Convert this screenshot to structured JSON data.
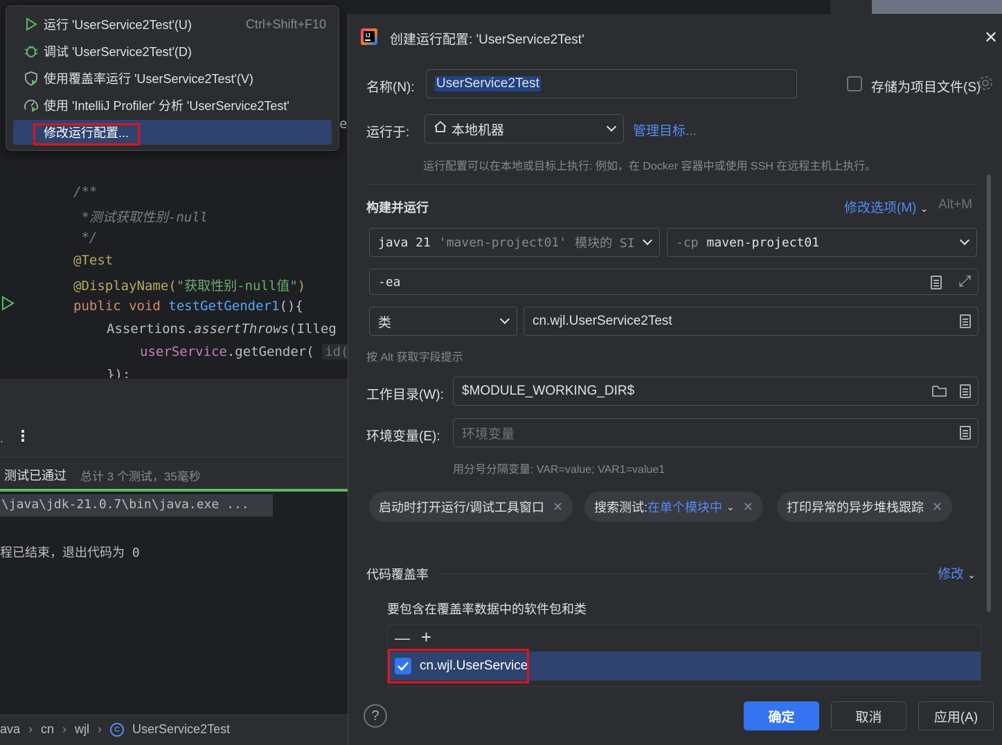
{
  "menu": {
    "items": [
      {
        "label": "运行 'UserService2Test'(U)",
        "shortcut": "Ctrl+Shift+F10",
        "icon": "run-icon"
      },
      {
        "label": "调试 'UserService2Test'(D)",
        "shortcut": "",
        "icon": "debug-icon"
      },
      {
        "label": "使用覆盖率运行 'UserService2Test'(V)",
        "shortcut": "",
        "icon": "coverage-icon"
      },
      {
        "label": "使用 'IntelliJ Profiler' 分析  'UserService2Test'",
        "shortcut": "",
        "icon": "profiler-icon"
      },
      {
        "label": "修改运行配置...",
        "shortcut": "",
        "icon": ""
      }
    ]
  },
  "editor": {
    "lines": {
      "l1": "/**",
      "l2": " *测试获取性别-null",
      "l3": " */",
      "l4": "@Test",
      "l5a": "@DisplayName(",
      "l5b": "\"获取性别-null值\"",
      "l5c": ")",
      "l6a": "public void ",
      "l6b": "testGetGender1",
      "l6c": "(){",
      "l7a": "Assertions.",
      "l7b": "assertThrows",
      "l7c": "(Illeg",
      "l8a": "userService",
      "l8b": ".getGender( ",
      "l8c": "id(",
      "l9": "});"
    },
    "stray_e": "e"
  },
  "run_panel": {
    "status": "测试已通过",
    "summary": "总计 3 个测试，35毫秒",
    "console_line1": "\\java\\jdk-21.0.7\\bin\\java.exe ...",
    "console_line2": "程已结束，退出代码为 0"
  },
  "breadcrumb": {
    "items": [
      "ava",
      "cn",
      "wjl",
      "UserService2Test"
    ]
  },
  "dialog": {
    "title": "创建运行配置: 'UserService2Test'",
    "name_label": "名称(N):",
    "name_value": "UserService2Test",
    "store_label": "存储为项目文件(S)",
    "run_on_label": "运行于:",
    "run_on_value": "本地机器",
    "manage_targets": "管理目标...",
    "run_on_hint": "运行配置可以在本地或目标上执行: 例如，在 Docker 容器中或使用 SSH 在远程主机上执行。",
    "build_run_title": "构建并运行",
    "modify_options": "修改选项(M)",
    "modify_shortcut": "Alt+M",
    "jdk_prefix": "java 21",
    "jdk_module": "'maven-project01'",
    "jdk_suffix": "模块的 SI",
    "cp_prefix": "-cp",
    "cp_value": "maven-project01",
    "vm_options": "-ea",
    "kind_value": "类",
    "class_value": "cn.wjl.UserService2Test",
    "alt_hint": "按 Alt 获取字段提示",
    "workdir_label": "工作目录(W):",
    "workdir_value": "$MODULE_WORKING_DIR$",
    "env_label": "环境变量(E):",
    "env_placeholder": "环境变量",
    "env_hint": "用分号分隔变量: VAR=value; VAR1=value1",
    "tags": {
      "t1": "启动时打开运行/调试工具窗口",
      "t2_prefix": "搜索测试: ",
      "t2_link": "在单个模块中",
      "t3": "打印异常的异步堆栈跟踪"
    },
    "coverage_title": "代码覆盖率",
    "coverage_modify": "修改",
    "coverage_subtitle": "要包含在覆盖率数据中的软件包和类",
    "coverage_item": "cn.wjl.UserService",
    "coverage_item_checked": true,
    "ok_label": "确定",
    "cancel_label": "取消",
    "apply_label": "应用(A)"
  },
  "colors": {
    "accent": "#3574f0",
    "link": "#548af7",
    "highlight_box": "#e0141f",
    "pass_green": "#5fb865"
  }
}
